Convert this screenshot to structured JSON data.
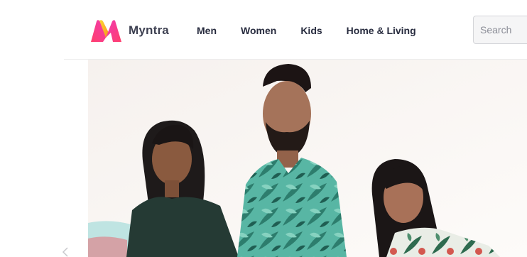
{
  "brand": {
    "name": "Myntra",
    "logo_icon": "myntra-m-logo-icon",
    "logo_colors": [
      "#ff3f6c",
      "#f13ab1",
      "#fdd835",
      "#f7941d"
    ]
  },
  "nav": {
    "items": [
      {
        "label": "Men"
      },
      {
        "label": "Women"
      },
      {
        "label": "Kids"
      },
      {
        "label": "Home & Living"
      }
    ]
  },
  "search": {
    "placeholder": "Search",
    "value": ""
  },
  "hero": {
    "image": "fashion-banner-three-models-photo"
  },
  "carousel": {
    "prev_icon": "chevron-left-icon"
  }
}
